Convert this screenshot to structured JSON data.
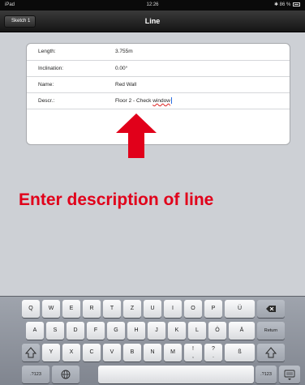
{
  "status_bar": {
    "carrier": "iPad",
    "time": "12:26",
    "battery": "86 %"
  },
  "nav": {
    "back_label": "Sketch 1",
    "title": "Line"
  },
  "form": {
    "rows": [
      {
        "label": "Length:",
        "value": "3.755m"
      },
      {
        "label": "Inclination:",
        "value": "0.00°"
      },
      {
        "label": "Name:",
        "value": "Red Wall"
      },
      {
        "label": "Descr.:",
        "value": "Floor 2 - Check ",
        "misspelled": "window"
      }
    ]
  },
  "annotation": {
    "text": "Enter description of line",
    "color": "#e1001a"
  },
  "keyboard": {
    "row1": [
      "Q",
      "W",
      "E",
      "R",
      "T",
      "Z",
      "U",
      "I",
      "O",
      "P",
      "Ü"
    ],
    "row2": [
      "A",
      "S",
      "D",
      "F",
      "G",
      "H",
      "J",
      "K",
      "L",
      "Ö",
      "Ä"
    ],
    "row2_return": "Return",
    "row3": [
      "Y",
      "X",
      "C",
      "V",
      "B",
      "N",
      "M",
      "!\n,",
      "?\n.",
      "ß"
    ],
    "numbers_label": ".?123",
    "icons": [
      "backspace-icon",
      "shift-icon",
      "globe-icon",
      "keyboard-hide-icon"
    ]
  },
  "colors": {
    "nav_bar": "#1f1f1f",
    "background": "#cdd0d5",
    "arrow": "#e1001a"
  }
}
